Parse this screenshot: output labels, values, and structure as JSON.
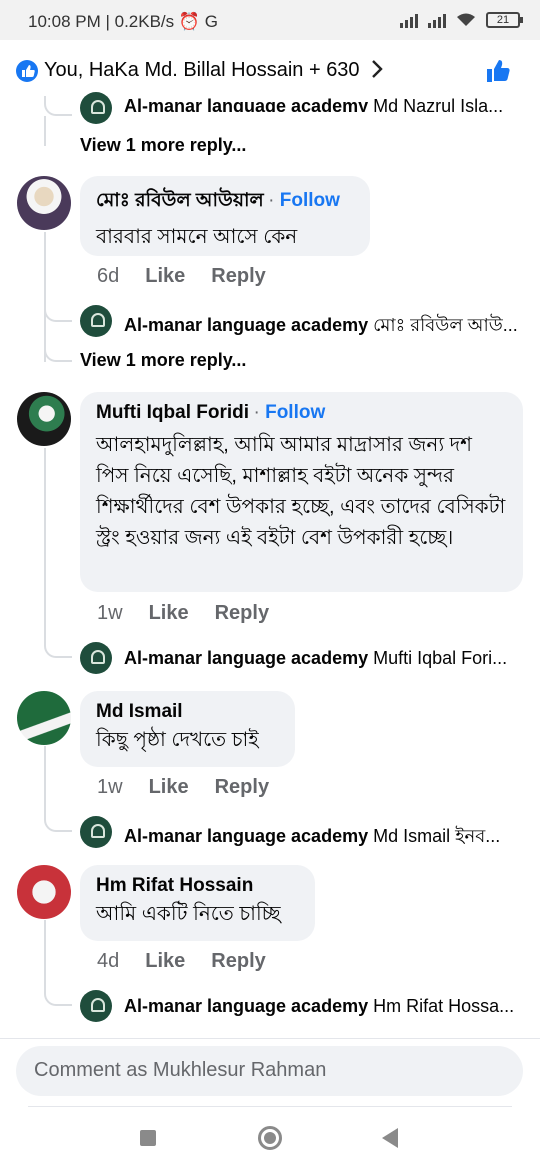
{
  "status": {
    "time_info": "10:08 PM | 0.2KB/s ⏰ G",
    "battery": "21"
  },
  "header": {
    "reactors": "You, HaKa Md. Billal Hossain + 630"
  },
  "top_partial_reply": {
    "name": "Al-manar language academy",
    "preview": "Md Nazrul Isla..."
  },
  "view_more_1": "View 1 more reply...",
  "comment1": {
    "name": "মোঃ রবিউল আউয়াল",
    "follow": "Follow",
    "text": "বারবার সামনে আসে কেন",
    "time": "6d",
    "like": "Like",
    "reply": "Reply",
    "reply_preview": {
      "name": "Al-manar language academy",
      "preview": "মোঃ রবিউল আউ..."
    }
  },
  "view_more_2": "View 1 more reply...",
  "comment2": {
    "name": "Mufti Iqbal Foridi",
    "follow": "Follow",
    "text": "আলহামদুলিল্লাহ, আমি আমার মাদ্রাসার জন্য দশ পিস নিয়ে এসেছি, মাশাল্লাহ বইটা অনেক সুন্দর শিক্ষার্থীদের  বেশ উপকার হচ্ছে, এবং তাদের বেসিকটা স্ট্রং হওয়ার জন্য এই বইটা বেশ উপকারী হচ্ছে।",
    "time": "1w",
    "like": "Like",
    "reply": "Reply",
    "reply_preview": {
      "name": "Al-manar language academy",
      "preview": "Mufti Iqbal Fori..."
    }
  },
  "comment3": {
    "name": "Md Ismail",
    "text": "কিছু পৃষ্ঠা দেখতে চাই",
    "time": "1w",
    "like": "Like",
    "reply": "Reply",
    "reply_preview": {
      "name": "Al-manar language academy",
      "preview": "Md Ismail ইনব..."
    }
  },
  "comment4": {
    "name": "Hm Rifat Hossain",
    "text": "আমি একটি নিতে চাচ্ছি",
    "time": "4d",
    "like": "Like",
    "reply": "Reply",
    "reply_preview": {
      "name": "Al-manar language academy",
      "preview": "Hm Rifat Hossa..."
    }
  },
  "composer": {
    "placeholder": "Comment as Mukhlesur Rahman"
  },
  "colors": {
    "accent": "#1877f2",
    "bubble": "#f0f2f5",
    "meta": "#65676b"
  }
}
